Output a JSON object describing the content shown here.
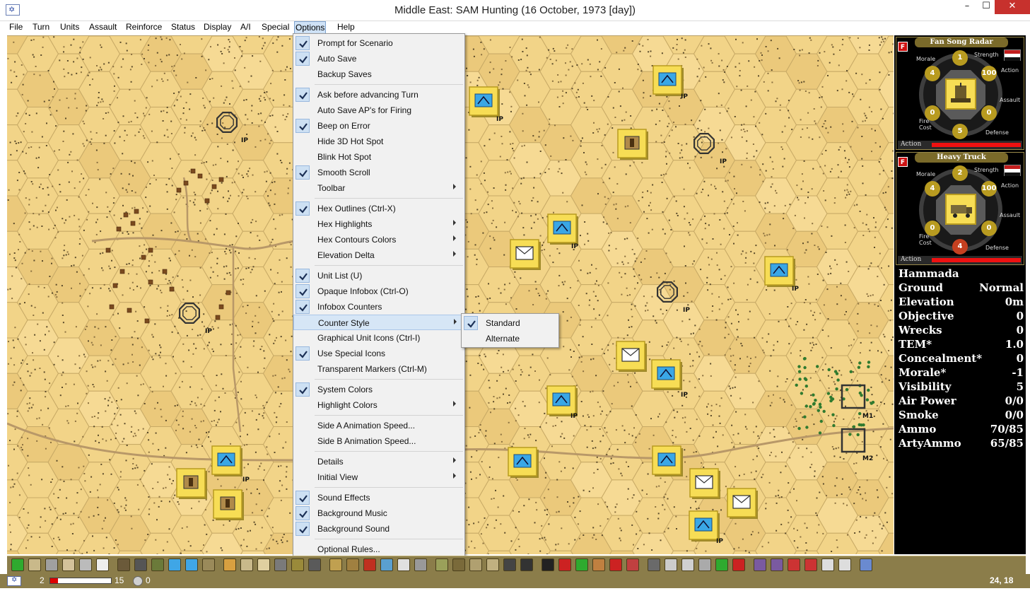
{
  "window": {
    "title": "Middle East: SAM Hunting (16 October, 1973 [day])",
    "minimize": "–",
    "maximize": "☐",
    "close": "✕"
  },
  "menubar": [
    "File",
    "Turn",
    "Units",
    "Assault",
    "Reinforce",
    "Status",
    "Display",
    "A/I",
    "Special",
    "Options",
    "Help"
  ],
  "active_menu": "Options",
  "options_menu": [
    {
      "label": "Prompt for Scenario",
      "checked": true,
      "submenu": false
    },
    {
      "label": "Auto Save",
      "checked": true,
      "submenu": false
    },
    {
      "label": "Backup Saves",
      "checked": false,
      "submenu": false
    },
    {
      "sep": true
    },
    {
      "label": "Ask before advancing Turn",
      "checked": true,
      "submenu": false
    },
    {
      "label": "Auto Save AP's for Firing",
      "checked": false,
      "submenu": false
    },
    {
      "label": "Beep on Error",
      "checked": true,
      "submenu": false
    },
    {
      "label": "Hide 3D Hot Spot",
      "checked": false,
      "submenu": false
    },
    {
      "label": "Blink Hot Spot",
      "checked": false,
      "submenu": false
    },
    {
      "label": "Smooth Scroll",
      "checked": true,
      "submenu": false
    },
    {
      "label": "Toolbar",
      "checked": false,
      "submenu": true
    },
    {
      "sep": true
    },
    {
      "label": "Hex Outlines (Ctrl-X)",
      "checked": true,
      "submenu": false
    },
    {
      "label": "Hex Highlights",
      "checked": false,
      "submenu": true
    },
    {
      "label": "Hex Contours Colors",
      "checked": false,
      "submenu": true
    },
    {
      "label": "Elevation Delta",
      "checked": false,
      "submenu": true
    },
    {
      "sep": true
    },
    {
      "label": "Unit List (U)",
      "checked": true,
      "submenu": false
    },
    {
      "label": "Opaque Infobox (Ctrl-O)",
      "checked": true,
      "submenu": false
    },
    {
      "label": "Infobox Counters",
      "checked": true,
      "submenu": false
    },
    {
      "label": "Counter Style",
      "checked": false,
      "submenu": true,
      "hot": true
    },
    {
      "label": "Graphical Unit Icons (Ctrl-I)",
      "checked": false,
      "submenu": false
    },
    {
      "label": "Use Special Icons",
      "checked": true,
      "submenu": false
    },
    {
      "label": "Transparent Markers (Ctrl-M)",
      "checked": false,
      "submenu": false
    },
    {
      "sep": true
    },
    {
      "label": "System Colors",
      "checked": true,
      "submenu": false
    },
    {
      "label": "Highlight Colors",
      "checked": false,
      "submenu": true
    },
    {
      "sep": true
    },
    {
      "label": "Side A Animation Speed...",
      "checked": false,
      "submenu": false
    },
    {
      "label": "Side B Animation Speed...",
      "checked": false,
      "submenu": false
    },
    {
      "sep": true
    },
    {
      "label": "Details",
      "checked": false,
      "submenu": true
    },
    {
      "label": "Initial View",
      "checked": false,
      "submenu": true
    },
    {
      "sep": true
    },
    {
      "label": "Sound Effects",
      "checked": true,
      "submenu": false
    },
    {
      "label": "Background Music",
      "checked": true,
      "submenu": false
    },
    {
      "label": "Background Sound",
      "checked": true,
      "submenu": false
    },
    {
      "sep": true
    },
    {
      "label": "Optional Rules...",
      "checked": false,
      "submenu": false
    }
  ],
  "counter_style_submenu": [
    {
      "label": "Standard",
      "checked": true
    },
    {
      "label": "Alternate",
      "checked": false
    }
  ],
  "unit_cards": [
    {
      "name": "Fan Song Radar",
      "badge": "F",
      "labels": {
        "morale": "Morale",
        "strength": "Strength",
        "action": "Action",
        "assault": "Assault",
        "fire_cost": "Fire\nCost",
        "defense": "Defense"
      },
      "strength": "1",
      "morale": "4",
      "action_points": "100",
      "assault": "0",
      "fire_cost": "0",
      "defense": "5",
      "action_label": "Action",
      "action_fraction": 1.0
    },
    {
      "name": "Heavy Truck",
      "badge": "F",
      "labels": {
        "morale": "Morale",
        "strength": "Strength",
        "action": "Action",
        "assault": "Assault",
        "fire_cost": "Fire\nCost",
        "defense": "Defense"
      },
      "strength": "2",
      "morale": "4",
      "action_points": "100",
      "assault": "0",
      "fire_cost": "0",
      "defense": "4",
      "action_label": "Action",
      "action_fraction": 1.0
    }
  ],
  "terrain_info": [
    {
      "k": "Hammada",
      "v": ""
    },
    {
      "k": "Ground",
      "v": "Normal"
    },
    {
      "k": "Elevation",
      "v": "0m"
    },
    {
      "k": "Objective",
      "v": "0"
    },
    {
      "k": "Wrecks",
      "v": "0"
    },
    {
      "k": "TEM*",
      "v": "1.0"
    },
    {
      "k": "Concealment*",
      "v": "0"
    },
    {
      "k": "Morale*",
      "v": "-1"
    },
    {
      "k": "Visibility",
      "v": "5"
    },
    {
      "k": "Air Power",
      "v": "0/0"
    },
    {
      "k": "Smoke",
      "v": "0/0"
    },
    {
      "k": "Ammo",
      "v": "70/85"
    },
    {
      "k": "ArtyAmmo",
      "v": "65/85"
    }
  ],
  "map_labels": {
    "ip": "IP",
    "m1": "M1",
    "m2": "M2"
  },
  "status": {
    "turn": "2",
    "max_turns": "15",
    "turn_fraction": 0.13,
    "victory_points": "0",
    "coords": "24, 18"
  },
  "colors": {
    "desert": "#f2d488",
    "counter": "#f7dd55",
    "counter_border": "#b89b20",
    "menu_check": "#cde0f3",
    "toolbar": "#8b7d4a",
    "close_button": "#c7312d"
  }
}
